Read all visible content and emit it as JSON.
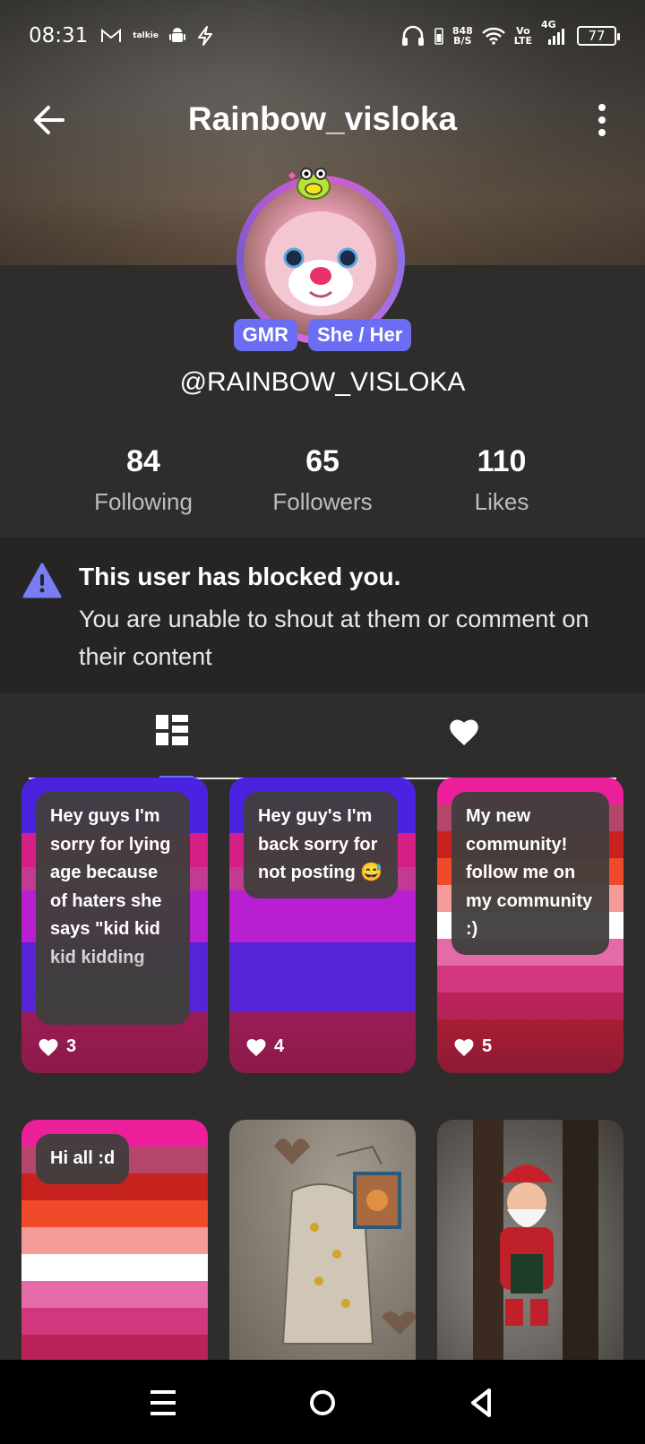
{
  "status_bar": {
    "time": "08:31",
    "left_icons": [
      "gmail-icon",
      "talkie-icon",
      "android-icon",
      "bolt-icon"
    ],
    "net_speed_value": "848",
    "net_speed_unit": "B/S",
    "volte_top": "Vo",
    "volte_bottom": "LTE",
    "network": "4G",
    "battery": "77"
  },
  "nav": {
    "title": "Rainbow_visloka"
  },
  "profile": {
    "badges": [
      "GMR",
      "She / Her"
    ],
    "handle": "@RAINBOW_VISLOKA",
    "stats": [
      {
        "value": "84",
        "label": "Following"
      },
      {
        "value": "65",
        "label": "Followers"
      },
      {
        "value": "110",
        "label": "Likes"
      }
    ]
  },
  "blocked_notice": {
    "title": "This user has blocked you.",
    "body": "You are unable to shout at them or comment on their content"
  },
  "tabs": [
    "grid-icon",
    "heart-icon"
  ],
  "posts": [
    {
      "text": "Hey guys I'm sorry for lying age because of haters she says \"kid kid kid kidding",
      "likes": "3",
      "style": "stripe-blue"
    },
    {
      "text": "Hey guy's I'm back sorry for not posting 😅",
      "likes": "4",
      "style": "stripe-blue"
    },
    {
      "text": "My new community! follow me on my community :)",
      "likes": "5",
      "style": "stripe-pink"
    },
    {
      "text": "Hi all :d",
      "style": "stripe-pink"
    },
    {
      "style": "photo-drawing"
    },
    {
      "style": "photo-santa"
    }
  ],
  "colors": {
    "accent": "#6b6ef2",
    "background": "#2e2d2b",
    "banner": "#262524"
  }
}
